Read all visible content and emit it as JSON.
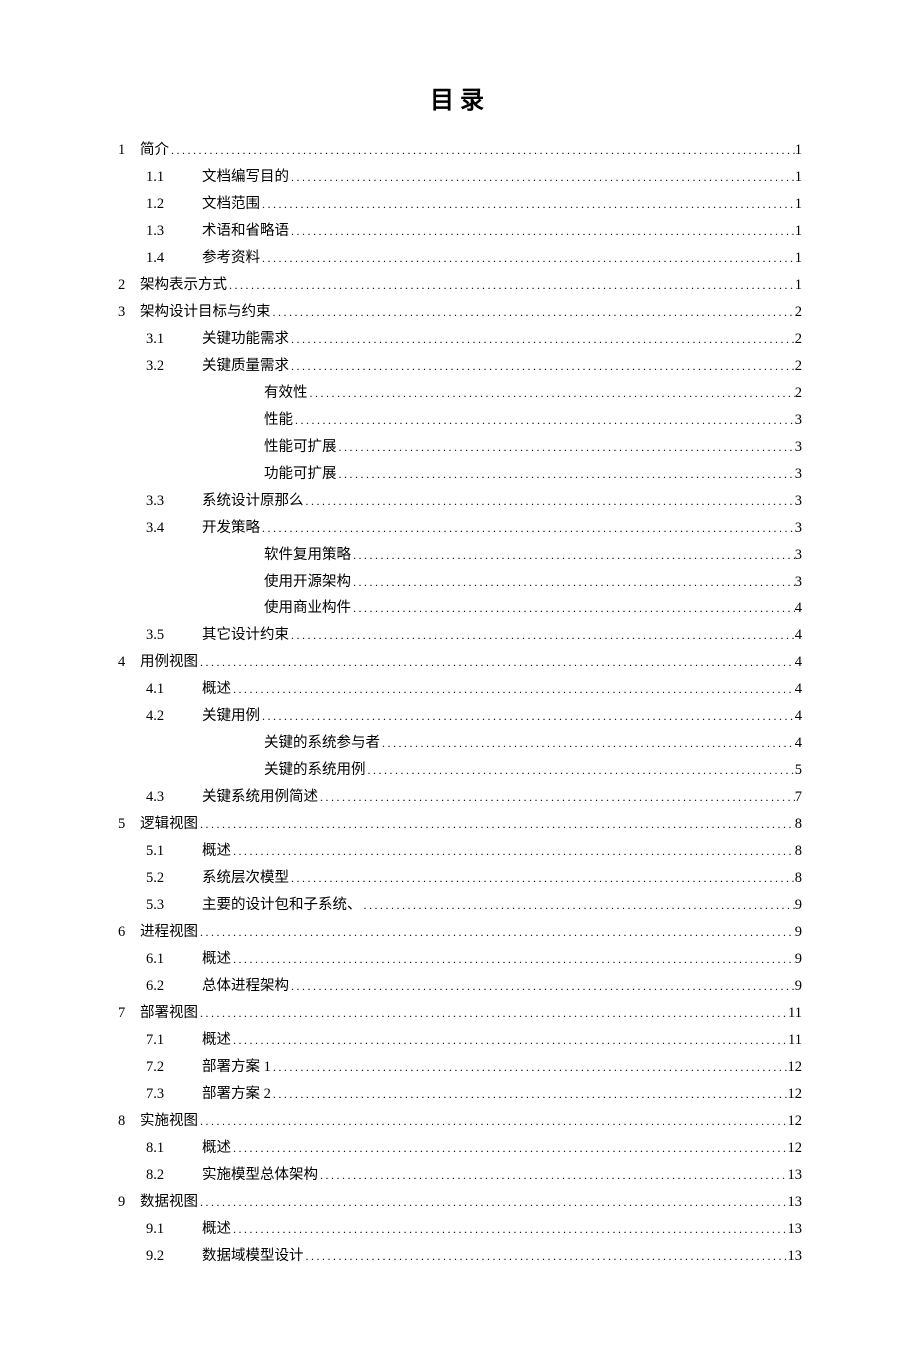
{
  "title": "目录",
  "toc": [
    {
      "level": 1,
      "num": "1",
      "label": "简介",
      "page": "1"
    },
    {
      "level": 2,
      "num": "1.1",
      "label": "文档编写目的",
      "page": "1"
    },
    {
      "level": 2,
      "num": "1.2",
      "label": "文档范围",
      "page": "1"
    },
    {
      "level": 2,
      "num": "1.3",
      "label": "术语和省略语",
      "page": "1"
    },
    {
      "level": 2,
      "num": "1.4",
      "label": "参考资料",
      "page": "1"
    },
    {
      "level": 1,
      "num": "2",
      "label": "架构表示方式",
      "page": "1"
    },
    {
      "level": 1,
      "num": "3",
      "label": "架构设计目标与约束",
      "page": "2"
    },
    {
      "level": 2,
      "num": "3.1",
      "label": "关键功能需求",
      "page": "2"
    },
    {
      "level": 2,
      "num": "3.2",
      "label": "关键质量需求",
      "page": "2"
    },
    {
      "level": 3,
      "num": "",
      "label": "有效性",
      "page": "2"
    },
    {
      "level": 3,
      "num": "",
      "label": "性能",
      "page": "3"
    },
    {
      "level": 3,
      "num": "",
      "label": "性能可扩展",
      "page": "3"
    },
    {
      "level": 3,
      "num": "",
      "label": "功能可扩展",
      "page": "3"
    },
    {
      "level": 2,
      "num": "3.3",
      "label": "系统设计原那么",
      "page": "3"
    },
    {
      "level": 2,
      "num": "3.4",
      "label": "开发策略",
      "page": "3"
    },
    {
      "level": 3,
      "num": "",
      "label": "软件复用策略",
      "page": "3"
    },
    {
      "level": 3,
      "num": "",
      "label": "使用开源架构",
      "page": "3"
    },
    {
      "level": 3,
      "num": "",
      "label": "使用商业构件",
      "page": "4"
    },
    {
      "level": 2,
      "num": "3.5",
      "label": "其它设计约束",
      "page": "4"
    },
    {
      "level": 1,
      "num": "4",
      "label": "用例视图",
      "page": "4"
    },
    {
      "level": 2,
      "num": "4.1",
      "label": "概述",
      "page": "4"
    },
    {
      "level": 2,
      "num": "4.2",
      "label": "关键用例",
      "page": "4"
    },
    {
      "level": 3,
      "num": "",
      "label": "关键的系统参与者",
      "page": "4"
    },
    {
      "level": 3,
      "num": "",
      "label": "关键的系统用例",
      "page": "5"
    },
    {
      "level": 2,
      "num": "4.3",
      "label": "关键系统用例简述",
      "page": "7"
    },
    {
      "level": 1,
      "num": "5",
      "label": "逻辑视图",
      "page": "8"
    },
    {
      "level": 2,
      "num": "5.1",
      "label": "概述",
      "page": "8"
    },
    {
      "level": 2,
      "num": "5.2",
      "label": "系统层次模型",
      "page": "8"
    },
    {
      "level": 2,
      "num": "5.3",
      "label": "主要的设计包和子系统、",
      "page": "9"
    },
    {
      "level": 1,
      "num": "6",
      "label": "进程视图",
      "page": "9"
    },
    {
      "level": 2,
      "num": "6.1",
      "label": "概述",
      "page": "9"
    },
    {
      "level": 2,
      "num": "6.2",
      "label": "总体进程架构",
      "page": "9"
    },
    {
      "level": 1,
      "num": "7",
      "label": "部署视图",
      "page": "11"
    },
    {
      "level": 2,
      "num": "7.1",
      "label": "概述",
      "page": "11"
    },
    {
      "level": 2,
      "num": "7.2",
      "label": "部署方案 1",
      "page": "12"
    },
    {
      "level": 2,
      "num": "7.3",
      "label": "部署方案 2",
      "page": "12"
    },
    {
      "level": 1,
      "num": "8",
      "label": "实施视图",
      "page": "12"
    },
    {
      "level": 2,
      "num": "8.1",
      "label": "概述",
      "page": "12"
    },
    {
      "level": 2,
      "num": "8.2",
      "label": "实施模型总体架构",
      "page": "13"
    },
    {
      "level": 1,
      "num": "9",
      "label": "数据视图",
      "page": "13"
    },
    {
      "level": 2,
      "num": "9.1",
      "label": "概述",
      "page": "13"
    },
    {
      "level": 2,
      "num": "9.2",
      "label": "数据域模型设计",
      "page": "13"
    }
  ]
}
